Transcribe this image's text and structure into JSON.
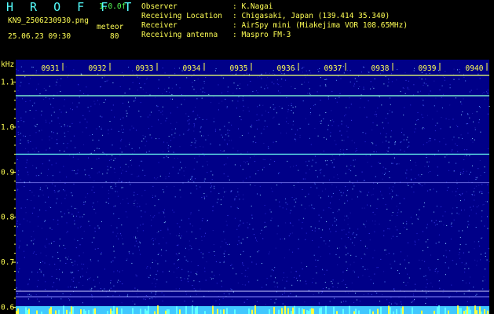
{
  "app": {
    "title": "H R O F F T",
    "version": "1.0.0f"
  },
  "file": {
    "name": "KN9_2506230930.png",
    "timestamp": "25.06.23 09:30"
  },
  "meteor": {
    "label": "meteor",
    "count": "80"
  },
  "info": {
    "observer_label": "Observer",
    "observer_value": ": K.Nagai",
    "location_label": "Receiving Location",
    "location_value": ": Chigasaki, Japan (139.414 35.340)",
    "receiver_label": "Receiver",
    "receiver_value": ": AirSpy mini (Miakejima VOR 108.65MHz)",
    "antenna_label": "Receiving antenna",
    "antenna_value": ": Maspro FM-3"
  },
  "colors": {
    "header_yellow": "#ffff55",
    "header_green": "#55ff55",
    "header_cyan": "#55ffff",
    "background": "#000088"
  },
  "chart_data": {
    "type": "heatmap",
    "ylabel": "kHz",
    "y_ticks": [
      "1.1",
      "1.0",
      "0.9",
      "0.8",
      "0.7",
      "0.6"
    ],
    "y_tick_values": [
      1.1,
      1.0,
      0.9,
      0.8,
      0.7,
      0.6
    ],
    "x_ticks": [
      "0931",
      "0932",
      "0933",
      "0934",
      "0935",
      "0936",
      "0937",
      "0938",
      "0939",
      "0940"
    ],
    "ylim": [
      0.585,
      1.15
    ],
    "signal_lines_khz": [
      1.115,
      1.07,
      0.94,
      0.877
    ],
    "grid": false
  }
}
